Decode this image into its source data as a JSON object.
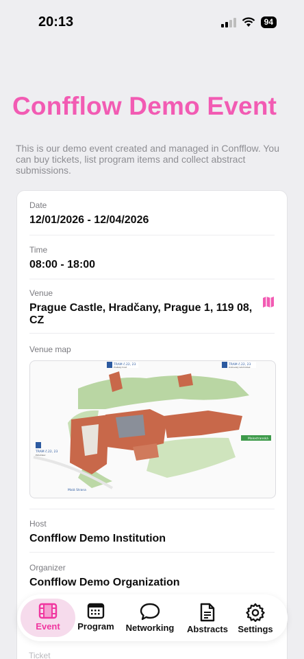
{
  "status": {
    "time": "20:13",
    "battery": "94"
  },
  "event": {
    "title": "Confflow Demo Event",
    "description": "This is our demo event created and managed in Confflow. You can buy tickets, list program items and collect abstract submissions."
  },
  "details": {
    "date_label": "Date",
    "date_value": "12/01/2026 - 12/04/2026",
    "time_label": "Time",
    "time_value": "08:00 - 18:00",
    "venue_label": "Venue",
    "venue_value": "Prague Castle, Hradčany, Prague 1, 119 08, CZ",
    "venue_map_label": "Venue map",
    "host_label": "Host",
    "host_value": "Confflow Demo Institution",
    "organizer_label": "Organizer",
    "organizer_value": "Confflow Demo Organization",
    "ticket_label": "Ticket"
  },
  "map": {
    "tram_top_left": "TRAM č.22, 23",
    "tram_top_left_sub": "Pražský hrad",
    "tram_top_right": "TRAM č.22, 23",
    "tram_top_right_sub": "Královský letohrádek",
    "tram_left": "TRAM č.22, 23",
    "tram_left_sub": "Pohořelec",
    "metro_left": "Malá Strana",
    "metro_right": "Malostranská"
  },
  "tabs": [
    {
      "label": "Event",
      "icon": "film-icon",
      "active": true
    },
    {
      "label": "Program",
      "icon": "calendar-icon",
      "active": false
    },
    {
      "label": "Networking",
      "icon": "chat-bubble-icon",
      "active": false
    },
    {
      "label": "Abstracts",
      "icon": "document-icon",
      "active": false
    },
    {
      "label": "Settings",
      "icon": "gear-icon",
      "active": false
    }
  ],
  "colors": {
    "accent": "#f25bb3",
    "active_tab_bg": "#f6dbec",
    "roof": "#c8684a"
  }
}
